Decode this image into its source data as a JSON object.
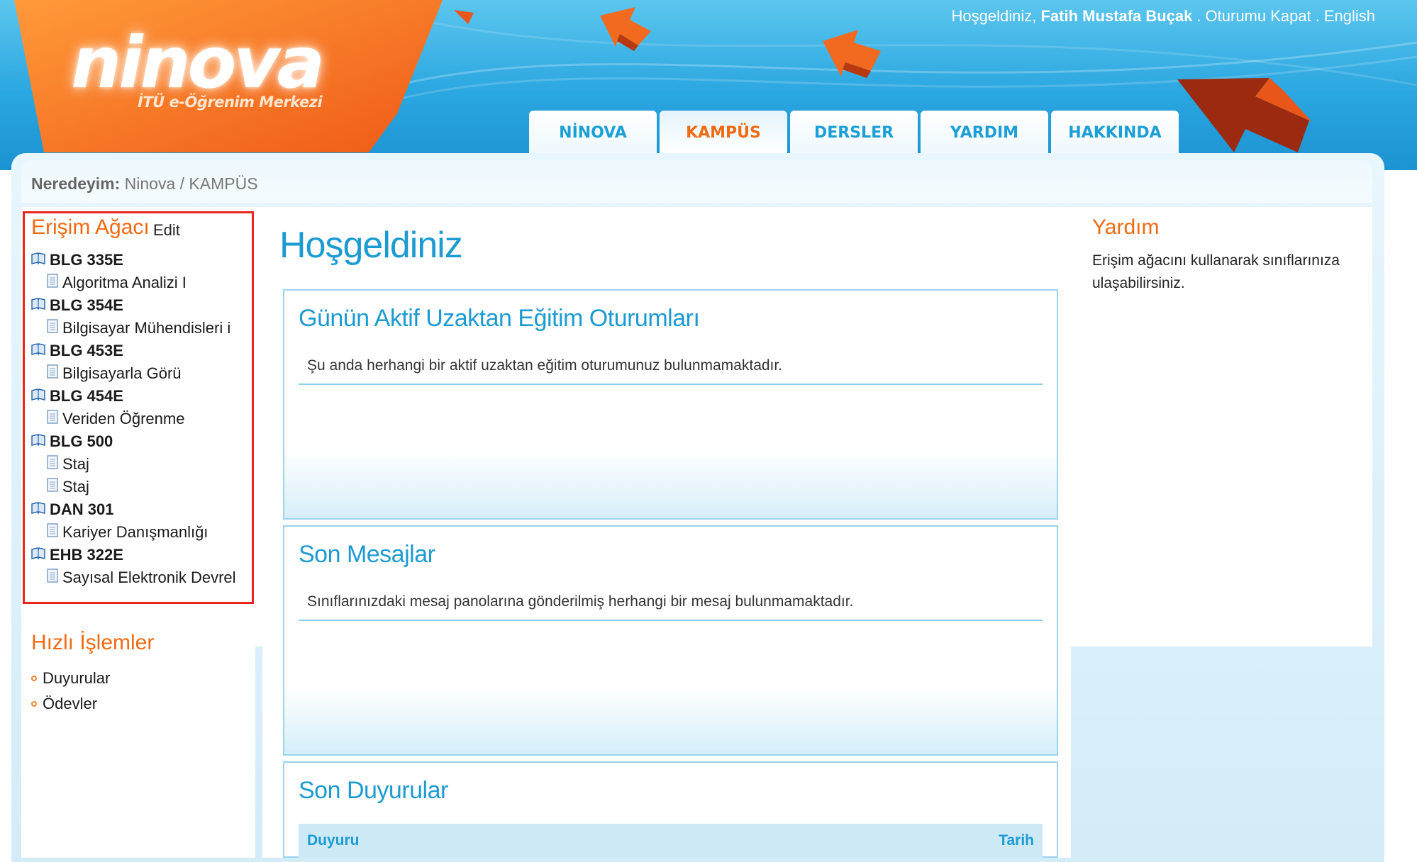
{
  "header": {
    "logo": "ninova",
    "logo_subtitle": "İTÜ e-Öğrenim Merkezi",
    "greeting": "Hoşgeldiniz,",
    "user_name": "Fatih Mustafa Buçak",
    "logout": "Oturumu Kapat",
    "language": "English",
    "colors": {
      "brand_orange": "#f06a12",
      "brand_blue": "#1c9bd3"
    }
  },
  "tabs": [
    {
      "label": "NİNOVA",
      "active": false
    },
    {
      "label": "KAMPÜS",
      "active": true
    },
    {
      "label": "DERSLER",
      "active": false
    },
    {
      "label": "YARDIM",
      "active": false
    },
    {
      "label": "HAKKINDA",
      "active": false
    }
  ],
  "breadcrumb": {
    "label": "Neredeyim:",
    "path": "Ninova / KAMPÜS"
  },
  "access_tree": {
    "title": "Erişim Ağacı",
    "edit": "Edit",
    "courses": [
      {
        "code": "BLG 335E",
        "classes": [
          "Algoritma Analizi I"
        ]
      },
      {
        "code": "BLG 354E",
        "classes": [
          "Bilgisayar Mühendisleri i"
        ]
      },
      {
        "code": "BLG 453E",
        "classes": [
          "Bilgisayarla Görü"
        ]
      },
      {
        "code": "BLG 454E",
        "classes": [
          "Veriden Öğrenme"
        ]
      },
      {
        "code": "BLG 500",
        "classes": [
          "Staj",
          "Staj"
        ]
      },
      {
        "code": "DAN 301",
        "classes": [
          "Kariyer Danışmanlığı"
        ]
      },
      {
        "code": "EHB 322E",
        "classes": [
          "Sayısal Elektronik Devrel"
        ]
      }
    ]
  },
  "quick_actions": {
    "title": "Hızlı İşlemler",
    "items": [
      "Duyurular",
      "Ödevler"
    ]
  },
  "main": {
    "title": "Hoşgeldiniz",
    "panels": [
      {
        "title": "Günün Aktif Uzaktan Eğitim Oturumları",
        "message": "Şu anda herhangi bir aktif uzaktan eğitim oturumunuz bulunmamaktadır."
      },
      {
        "title": "Son Mesajlar",
        "message": "Sınıflarınızdaki mesaj panolarına gönderilmiş herhangi bir mesaj bulunmamaktadır."
      },
      {
        "title": "Son Duyurular",
        "columns": [
          "Duyuru",
          "Tarih"
        ]
      }
    ]
  },
  "help": {
    "title": "Yardım",
    "text": "Erişim ağacını kullanarak sınıflarınıza ulaşabilirsiniz."
  }
}
